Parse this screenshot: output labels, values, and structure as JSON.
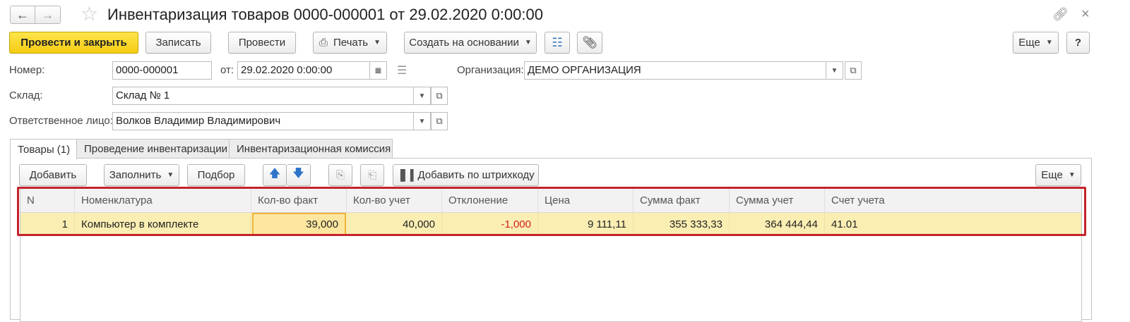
{
  "window": {
    "title": "Инвентаризация товаров 0000-000001 от 29.02.2020 0:00:00",
    "back_icon": "arrow-left-icon",
    "forward_icon": "arrow-right-icon",
    "favorite_icon": "star-icon",
    "link_icon": "link-icon",
    "close_icon": "close-icon"
  },
  "toolbar": {
    "post_close": "Провести и закрыть",
    "save": "Записать",
    "post": "Провести",
    "print": "Печать",
    "create_based": "Создать на основании",
    "more": "Еще",
    "help": "?"
  },
  "header": {
    "number_label": "Номер:",
    "number_value": "0000-000001",
    "date_label": "от:",
    "date_value": "29.02.2020  0:00:00",
    "org_label": "Организация:",
    "org_value": "ДЕМО ОРГАНИЗАЦИЯ",
    "warehouse_label": "Склад:",
    "warehouse_value": "Склад № 1",
    "responsible_label": "Ответственное лицо:",
    "responsible_value": "Волков Владимир Владимирович"
  },
  "tabs": [
    {
      "label": "Товары (1)"
    },
    {
      "label": "Проведение инвентаризации"
    },
    {
      "label": "Инвентаризационная комиссия"
    }
  ],
  "table_toolbar": {
    "add": "Добавить",
    "fill": "Заполнить",
    "pick": "Подбор",
    "add_barcode": "Добавить по штрихкоду",
    "more": "Еще"
  },
  "table": {
    "columns": [
      "N",
      "Номенклатура",
      "Кол-во факт",
      "Кол-во учет",
      "Отклонение",
      "Цена",
      "Сумма факт",
      "Сумма учет",
      "Счет учета"
    ],
    "rows": [
      {
        "n": "1",
        "item": "Компьютер в комплекте",
        "qty_fact": "39,000",
        "qty_book": "40,000",
        "deviation": "-1,000",
        "price": "9 111,11",
        "sum_fact": "355 333,33",
        "sum_book": "364 444,44",
        "account": "41.01"
      }
    ]
  },
  "colors": {
    "primary_button": "#f5cc14",
    "selected_row": "#fbeeb3",
    "negative_value": "#d21f1f",
    "highlight_frame": "#c4232b"
  }
}
